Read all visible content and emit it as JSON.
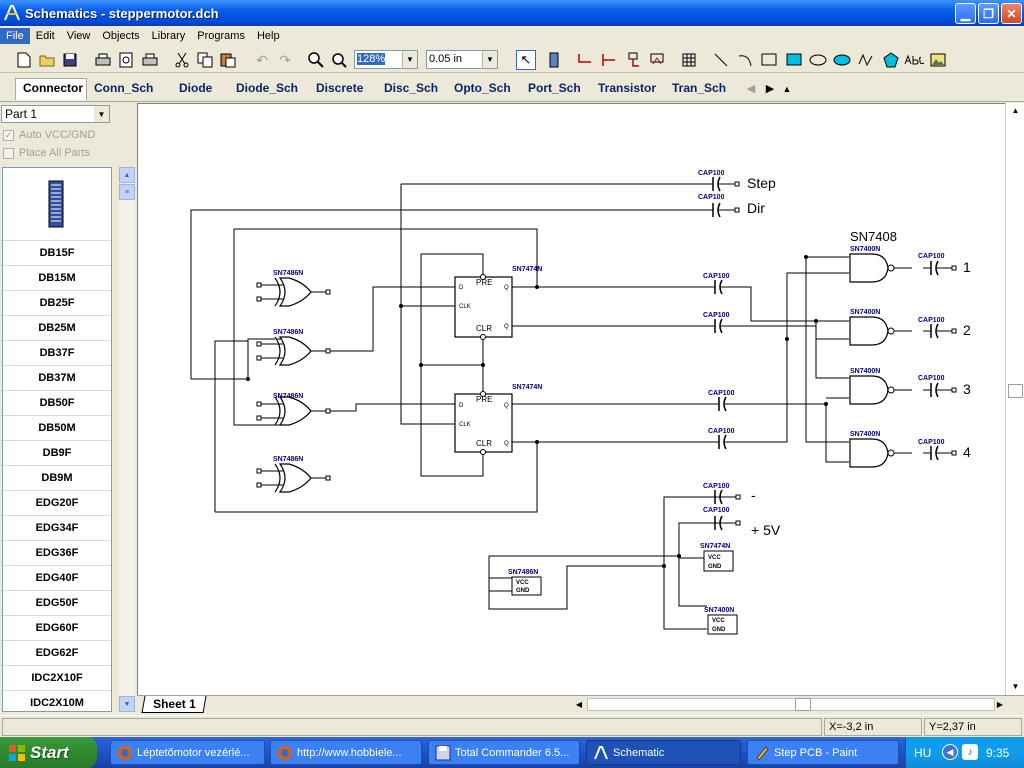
{
  "window": {
    "title": "Schematics - steppermotor.dch"
  },
  "menu": [
    "File",
    "Edit",
    "View",
    "Objects",
    "Library",
    "Programs",
    "Help"
  ],
  "toolbar": {
    "zoom": "128%",
    "grid": "0.05 in"
  },
  "libraries": [
    "Connector",
    "Conn_Sch",
    "Diode",
    "Diode_Sch",
    "Discrete",
    "Disc_Sch",
    "Opto_Sch",
    "Port_Sch",
    "Transistor",
    "Tran_Sch"
  ],
  "left_panel": {
    "part": "Part 1",
    "auto_vcc": "Auto VCC/GND",
    "place_all": "Place All Parts",
    "parts": [
      "DB15F",
      "DB15M",
      "DB25F",
      "DB25M",
      "DB37F",
      "DB37M",
      "DB50F",
      "DB50M",
      "DB9F",
      "DB9M",
      "EDG20F",
      "EDG34F",
      "EDG36F",
      "EDG40F",
      "EDG50F",
      "EDG60F",
      "EDG62F",
      "IDC2X10F",
      "IDC2X10M"
    ]
  },
  "schematic": {
    "xor_label": "SN7486N",
    "ff_label": "SN7474N",
    "nand_label": "SN7400N",
    "cap_label": "CAP100",
    "sn7408": "SN7408",
    "pre": "PRE",
    "clr": "CLR",
    "clk": "CLK",
    "d": "D",
    "q": "Q",
    "vcc": "VCC",
    "gnd": "GND",
    "step": "Step",
    "dir": "Dir",
    "out": [
      "1",
      "2",
      "3",
      "4"
    ],
    "minus": "-",
    "plus5v": "+ 5V"
  },
  "sheet_tab": "Sheet 1",
  "status": {
    "x": "X=-3,2 in",
    "y": "Y=2,37 in"
  },
  "taskbar": {
    "start": "Start",
    "tasks": [
      "Léptetőmotor vezérlé...",
      "http://www.hobbiele...",
      "Total Commander 6.5...",
      "Schematic",
      "Step PCB - Paint"
    ],
    "lang": "HU",
    "clock": "9:35"
  },
  "colors": {
    "title_blue": "#0a5de8",
    "library_text": "#0a246a",
    "chip_label": "#000080",
    "wire": "#000000"
  }
}
